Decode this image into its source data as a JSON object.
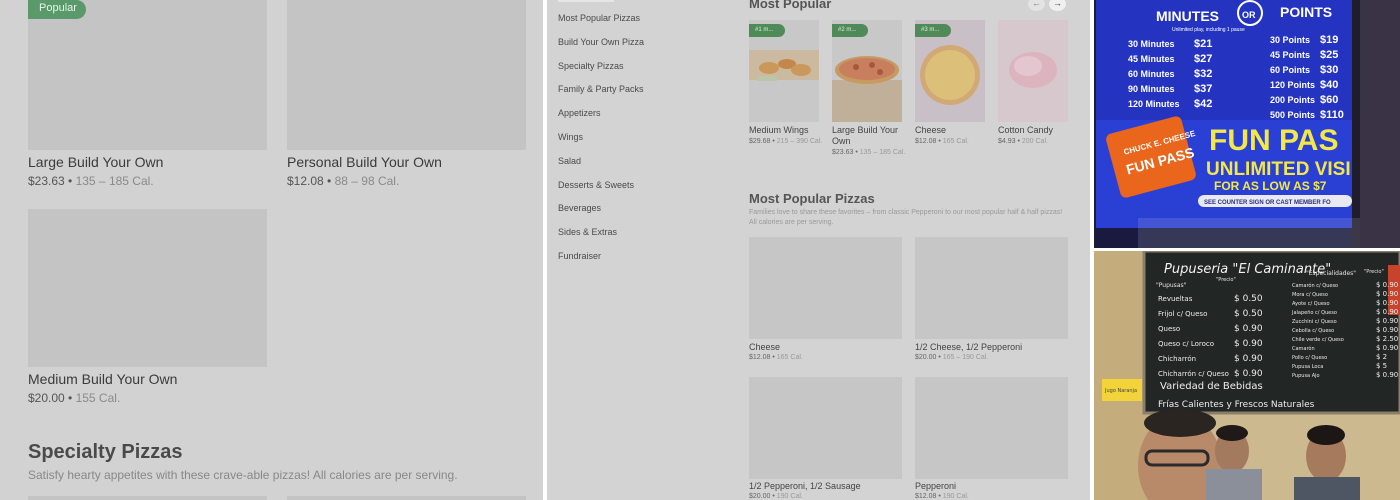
{
  "panel1": {
    "badge": "Popular",
    "items": [
      {
        "name": "Large Build Your Own",
        "price": "$23.63",
        "cal": "135 – 185 Cal."
      },
      {
        "name": "Personal Build Your Own",
        "price": "$12.08",
        "cal": "88 – 98 Cal."
      },
      {
        "name": "Medium Build Your Own",
        "price": "$20.00",
        "cal": "155 Cal."
      }
    ],
    "section_title": "Specialty Pizzas",
    "section_desc": "Satisfy hearty appetites with these crave-able pizzas! All calories are per serving."
  },
  "panel2": {
    "nav": [
      "Most Popular Pizzas",
      "Build Your Own Pizza",
      "Specialty Pizzas",
      "Family & Party Packs",
      "Appetizers",
      "Wings",
      "Salad",
      "Desserts & Sweets",
      "Beverages",
      "Sides & Extras",
      "Fundraiser"
    ],
    "most_popular_title": "Most Popular",
    "arrow_prev": "←",
    "arrow_next": "→",
    "popular_items": [
      {
        "rank": "#1 m...",
        "name": "Medium Wings",
        "price": "$29.68",
        "cal": "215 – 390 Cal."
      },
      {
        "rank": "#2 m...",
        "name": "Large Build Your Own",
        "price": "$23.63",
        "cal": "135 – 185 Cal."
      },
      {
        "rank": "#3 m...",
        "name": "Cheese",
        "price": "$12.08",
        "cal": "165 Cal."
      },
      {
        "rank": "",
        "name": "Cotton Candy",
        "price": "$4.93",
        "cal": "200 Cal."
      }
    ],
    "mpp_title": "Most Popular Pizzas",
    "mpp_desc": "Families love to share these favorites – from classic Pepperoni to our most popular half & half pizzas! All calories are per serving.",
    "grid_items": [
      {
        "name": "Cheese",
        "price": "$12.08",
        "cal": "165 Cal."
      },
      {
        "name": "1/2 Cheese, 1/2 Pepperoni",
        "price": "$20.00",
        "cal": "165 – 190 Cal."
      },
      {
        "name": "1/2 Pepperoni, 1/2 Sausage",
        "price": "$20.00",
        "cal": "190 Cal."
      },
      {
        "name": "Pepperoni",
        "price": "$12.08",
        "cal": "190 Cal."
      }
    ]
  },
  "panel3": {
    "minutes_head": "MINUTES",
    "or": "OR",
    "points_head": "POINTS",
    "minutes_sub": "Unlimited play, including 1 pause",
    "minutes": [
      {
        "label": "30 Minutes",
        "price": "$21"
      },
      {
        "label": "45 Minutes",
        "price": "$27"
      },
      {
        "label": "60 Minutes",
        "price": "$32"
      },
      {
        "label": "90 Minutes",
        "price": "$37"
      },
      {
        "label": "120 Minutes",
        "price": "$42"
      }
    ],
    "points": [
      {
        "label": "30 Points",
        "price": "$19"
      },
      {
        "label": "45 Points",
        "price": "$25"
      },
      {
        "label": "60 Points",
        "price": "$30"
      },
      {
        "label": "120 Points",
        "price": "$40"
      },
      {
        "label": "200 Points",
        "price": "$60"
      },
      {
        "label": "500 Points",
        "price": "$110"
      }
    ],
    "pass_brand": "CHUCK E. CHEESE",
    "pass_name": "FUN PASS",
    "promo_big": "FUN PAS",
    "promo_line1": "UNLIMITED VISI",
    "promo_line2": "FOR AS LOW AS $7",
    "promo_line3": "SEE COUNTER SIGN OR CAST MEMBER FO"
  },
  "panel4": {
    "title": "Pupuseria \"El Caminante\"",
    "col1_head": "\"Pupusas\"",
    "col1_price_head": "\"Precio\"",
    "col2_head": "\"Especialidades\"",
    "col2_price_head": "\"Precio\"",
    "left_rows": [
      {
        "name": "Revueltas",
        "price": "$ 0.50"
      },
      {
        "name": "Frijol c/ Queso",
        "price": "$ 0.50"
      },
      {
        "name": "Queso",
        "price": "$ 0.90"
      },
      {
        "name": "Queso c/ Loroco",
        "price": "$ 0.90"
      },
      {
        "name": "Chicharrón",
        "price": "$ 0.90"
      },
      {
        "name": "Chicharrón c/ Queso",
        "price": "$ 0.90"
      }
    ],
    "right_rows": [
      {
        "name": "Camarón c/ Queso",
        "price": "$ 0.90"
      },
      {
        "name": "Mora c/ Queso",
        "price": "$ 0.90"
      },
      {
        "name": "Ayote c/ Queso",
        "price": "$ 0.90"
      },
      {
        "name": "Jalapeño c/ Queso",
        "price": "$ 0.90"
      },
      {
        "name": "Zucchini c/ Queso",
        "price": "$ 0.90"
      },
      {
        "name": "Cebolla c/ Queso",
        "price": "$ 0.90"
      },
      {
        "name": "Chile verde c/ Queso",
        "price": "$ 2.50"
      },
      {
        "name": "Camarón",
        "price": "$ 0.90"
      },
      {
        "name": "Pollo c/ Queso",
        "price": "$ 2"
      },
      {
        "name": "Pupusa Loca",
        "price": "$ 5"
      },
      {
        "name": "Pupusa Ajo",
        "price": "$ 0.90"
      }
    ],
    "footer1": "Variedad de Bebidas",
    "footer2": "Frías Calientes y Frescos Naturales",
    "sticky_note": "Jugo Naranja"
  }
}
